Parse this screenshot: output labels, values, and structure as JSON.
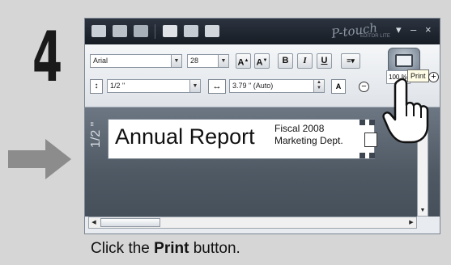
{
  "step": {
    "number": "4"
  },
  "window": {
    "brand": "P-touch",
    "brand_sub": "EDITOR LITE",
    "controls": {
      "minimize": "–",
      "close": "×",
      "menu": "▾"
    }
  },
  "toolbar": {
    "font_name": "Arial",
    "font_size": "28",
    "bold": "B",
    "italic": "I",
    "underline": "U",
    "grow_font": "A",
    "shrink_font": "A",
    "tape_width": "1/2 \"",
    "length": "3.79 \" (Auto)",
    "zoom": "100 %",
    "zoom_out": "−",
    "zoom_in": "+",
    "print_tooltip": "Print"
  },
  "label": {
    "vertical_size": "1/2 \"",
    "main_text": "Annual Report",
    "line1": "Fiscal 2008",
    "line2": "Marketing Dept."
  },
  "caption": {
    "before": "Click the ",
    "bold": "Print",
    "after": " button."
  },
  "colors": {
    "titlebar": "#1f2630",
    "canvas": "#5b6570",
    "tooltip_bg": "#fffde6"
  }
}
